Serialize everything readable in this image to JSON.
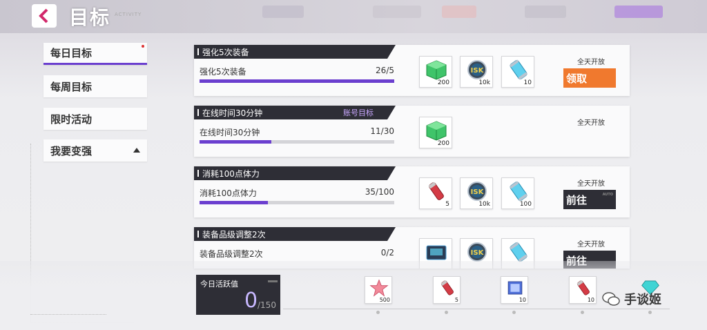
{
  "header": {
    "title": "目标",
    "subtitle": "ACTIVITY"
  },
  "menu": {
    "items": [
      {
        "label": "每日目标",
        "active": true
      },
      {
        "label": "每周目标",
        "active": false
      },
      {
        "label": "限时活动",
        "active": false
      },
      {
        "label": "我要变强",
        "active": false
      }
    ]
  },
  "tasks": [
    {
      "title": "强化5次装备",
      "label": "强化5次装备",
      "count": "26/5",
      "progress": 1.0,
      "rewards": [
        {
          "icon": "green-cube-icon",
          "qty": "200"
        },
        {
          "icon": "isk-coin-icon",
          "qty": "10k"
        },
        {
          "icon": "blue-canister-icon",
          "qty": "10"
        }
      ],
      "availability": "全天开放",
      "button": "领取",
      "button_type": "claim"
    },
    {
      "title": "在线时间30分钟",
      "tag": "账号目标",
      "label": "在线时间30分钟",
      "count": "11/30",
      "progress": 0.37,
      "rewards": [
        {
          "icon": "green-cube-icon",
          "qty": "200"
        }
      ],
      "availability": "全天开放"
    },
    {
      "title": "消耗100点体力",
      "label": "消耗100点体力",
      "count": "35/100",
      "progress": 0.35,
      "rewards": [
        {
          "icon": "red-vial-icon",
          "qty": "5"
        },
        {
          "icon": "isk-coin-icon",
          "qty": "10k"
        },
        {
          "icon": "blue-canister-icon",
          "qty": "100"
        }
      ],
      "availability": "全天开放",
      "button": "前往",
      "button_sub": "AUTO",
      "button_type": "go"
    },
    {
      "title": "装备品级调整2次",
      "label": "装备品级调整2次",
      "count": "0/2",
      "progress": 0,
      "rewards": [
        {
          "icon": "tech-crate-icon",
          "qty": ""
        },
        {
          "icon": "isk-coin-icon",
          "qty": ""
        },
        {
          "icon": "blue-canister-icon",
          "qty": ""
        }
      ],
      "availability": "全天开放",
      "button": "前往",
      "button_type": "go"
    }
  ],
  "activity": {
    "label": "今日活跃值",
    "value": "0",
    "max": "/150",
    "milestones": [
      {
        "icon": "pink-star-crystal-icon",
        "qty": "500"
      },
      {
        "icon": "red-vial-icon",
        "qty": "5"
      },
      {
        "icon": "blue-crate-icon",
        "qty": "10"
      },
      {
        "icon": "red-vial-icon",
        "qty": "10"
      },
      {
        "icon": "cyan-gem-icon",
        "qty": ""
      }
    ]
  },
  "watermark": {
    "text": "手谈姬"
  },
  "colors": {
    "accent": "#6b3fcf",
    "claim": "#f0792e",
    "dark": "#2e2e36"
  }
}
